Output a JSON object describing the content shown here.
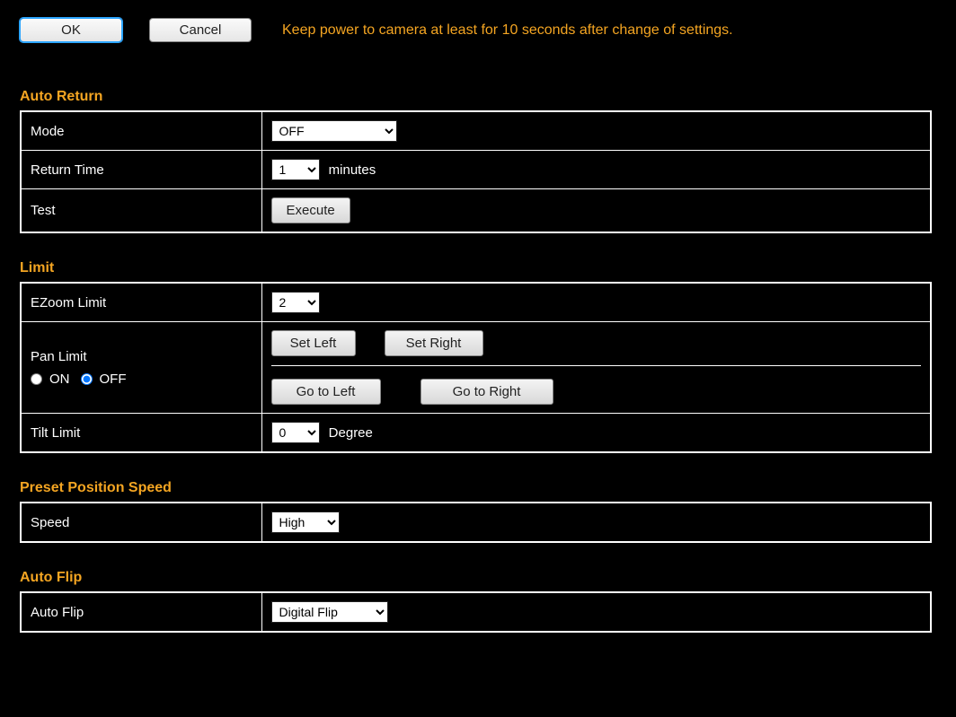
{
  "top": {
    "ok_label": "OK",
    "cancel_label": "Cancel",
    "message": "Keep power to camera at least for 10 seconds after change of settings."
  },
  "auto_return": {
    "title": "Auto Return",
    "mode_label": "Mode",
    "mode_value": "OFF",
    "return_time_label": "Return Time",
    "return_time_value": "1",
    "return_time_unit": "minutes",
    "test_label": "Test",
    "execute_label": "Execute"
  },
  "limit": {
    "title": "Limit",
    "ezoom_label": "EZoom Limit",
    "ezoom_value": "2",
    "pan_label": "Pan Limit",
    "pan_on_label": "ON",
    "pan_off_label": "OFF",
    "pan_selected": "OFF",
    "set_left_label": "Set Left",
    "set_right_label": "Set Right",
    "goto_left_label": "Go to Left",
    "goto_right_label": "Go to Right",
    "tilt_label": "Tilt Limit",
    "tilt_value": "0",
    "tilt_unit": "Degree"
  },
  "preset_speed": {
    "title": "Preset Position Speed",
    "speed_label": "Speed",
    "speed_value": "High"
  },
  "auto_flip": {
    "title": "Auto Flip",
    "flip_label": "Auto Flip",
    "flip_value": "Digital Flip"
  }
}
